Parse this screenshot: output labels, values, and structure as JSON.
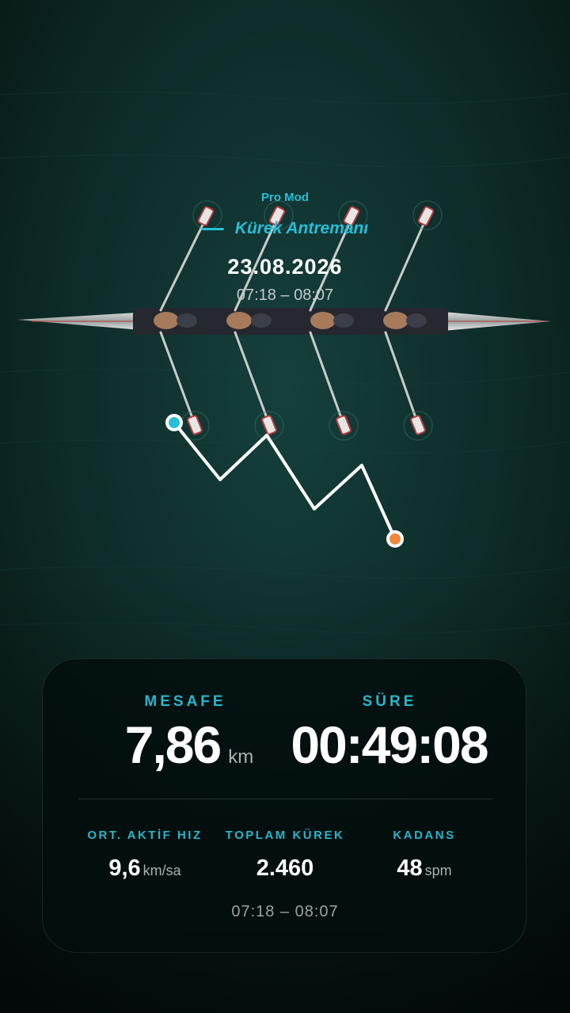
{
  "header": {
    "mode": "Pro Mod",
    "title": "Kürek Antremanı",
    "date": "23.08.2026",
    "time_range": "07:18 – 08:07"
  },
  "route": {
    "start_color": "#27bfd8",
    "end_color": "#f0883e",
    "line_color": "#ffffff"
  },
  "stats": {
    "distance": {
      "label": "MESAFE",
      "value": "7,86",
      "unit": "km"
    },
    "duration": {
      "label": "SÜRE",
      "value": "00:49:08"
    },
    "avg_speed": {
      "label": "ORT. AKTİF HIZ",
      "value": "9,6",
      "unit": "km/sa"
    },
    "total_strokes": {
      "label": "TOPLAM KÜREK",
      "value": "2.460"
    },
    "cadence": {
      "label": "KADANS",
      "value": "48",
      "unit": "spm"
    },
    "footer_time": "07:18 – 08:07"
  },
  "colors": {
    "accent": "#27bfd8",
    "water": "#0c2422"
  }
}
